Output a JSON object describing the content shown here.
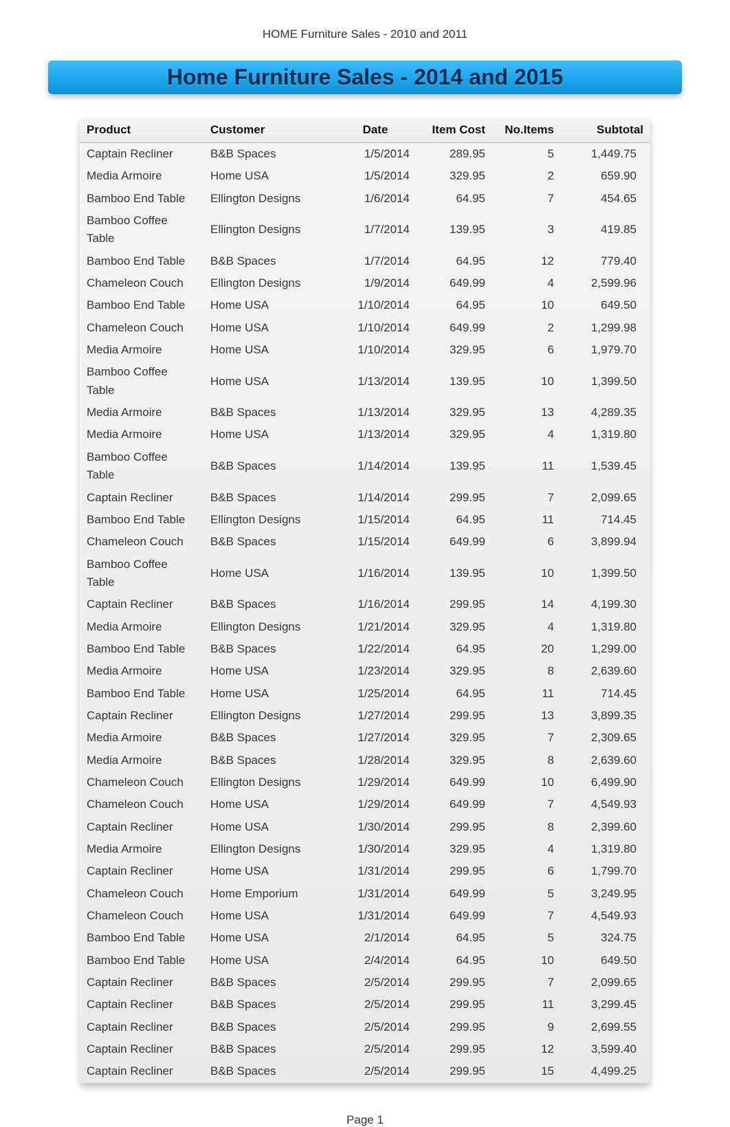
{
  "doc_header": "HOME Furniture Sales - 2010 and 2011",
  "title": "Home Furniture Sales - 2014 and 2015",
  "columns": {
    "product": "Product",
    "customer": "Customer",
    "date": "Date",
    "item_cost": "Item Cost",
    "no_items": "No.Items",
    "subtotal": "Subtotal"
  },
  "rows": [
    {
      "product": "Captain Recliner",
      "customer": "B&B Spaces",
      "date": "1/5/2014",
      "item_cost": "289.95",
      "no_items": "5",
      "subtotal": "1,449.75"
    },
    {
      "product": "Media Armoire",
      "customer": "Home USA",
      "date": "1/5/2014",
      "item_cost": "329.95",
      "no_items": "2",
      "subtotal": "659.90"
    },
    {
      "product": "Bamboo End Table",
      "customer": "Ellington Designs",
      "date": "1/6/2014",
      "item_cost": "64.95",
      "no_items": "7",
      "subtotal": "454.65"
    },
    {
      "product": "Bamboo Coffee Table",
      "customer": "Ellington Designs",
      "date": "1/7/2014",
      "item_cost": "139.95",
      "no_items": "3",
      "subtotal": "419.85"
    },
    {
      "product": "Bamboo End Table",
      "customer": "B&B Spaces",
      "date": "1/7/2014",
      "item_cost": "64.95",
      "no_items": "12",
      "subtotal": "779.40"
    },
    {
      "product": "Chameleon Couch",
      "customer": "Ellington Designs",
      "date": "1/9/2014",
      "item_cost": "649.99",
      "no_items": "4",
      "subtotal": "2,599.96"
    },
    {
      "product": "Bamboo End Table",
      "customer": "Home USA",
      "date": "1/10/2014",
      "item_cost": "64.95",
      "no_items": "10",
      "subtotal": "649.50"
    },
    {
      "product": "Chameleon Couch",
      "customer": "Home USA",
      "date": "1/10/2014",
      "item_cost": "649.99",
      "no_items": "2",
      "subtotal": "1,299.98"
    },
    {
      "product": "Media Armoire",
      "customer": "Home USA",
      "date": "1/10/2014",
      "item_cost": "329.95",
      "no_items": "6",
      "subtotal": "1,979.70"
    },
    {
      "product": "Bamboo Coffee Table",
      "customer": "Home USA",
      "date": "1/13/2014",
      "item_cost": "139.95",
      "no_items": "10",
      "subtotal": "1,399.50"
    },
    {
      "product": "Media Armoire",
      "customer": "B&B Spaces",
      "date": "1/13/2014",
      "item_cost": "329.95",
      "no_items": "13",
      "subtotal": "4,289.35"
    },
    {
      "product": "Media Armoire",
      "customer": "Home USA",
      "date": "1/13/2014",
      "item_cost": "329.95",
      "no_items": "4",
      "subtotal": "1,319.80"
    },
    {
      "product": "Bamboo Coffee Table",
      "customer": "B&B Spaces",
      "date": "1/14/2014",
      "item_cost": "139.95",
      "no_items": "11",
      "subtotal": "1,539.45"
    },
    {
      "product": "Captain Recliner",
      "customer": "B&B Spaces",
      "date": "1/14/2014",
      "item_cost": "299.95",
      "no_items": "7",
      "subtotal": "2,099.65"
    },
    {
      "product": "Bamboo End Table",
      "customer": "Ellington Designs",
      "date": "1/15/2014",
      "item_cost": "64.95",
      "no_items": "11",
      "subtotal": "714.45"
    },
    {
      "product": "Chameleon Couch",
      "customer": "B&B Spaces",
      "date": "1/15/2014",
      "item_cost": "649.99",
      "no_items": "6",
      "subtotal": "3,899.94"
    },
    {
      "product": "Bamboo Coffee Table",
      "customer": "Home USA",
      "date": "1/16/2014",
      "item_cost": "139.95",
      "no_items": "10",
      "subtotal": "1,399.50"
    },
    {
      "product": "Captain Recliner",
      "customer": "B&B Spaces",
      "date": "1/16/2014",
      "item_cost": "299.95",
      "no_items": "14",
      "subtotal": "4,199.30"
    },
    {
      "product": "Media Armoire",
      "customer": "Ellington Designs",
      "date": "1/21/2014",
      "item_cost": "329.95",
      "no_items": "4",
      "subtotal": "1,319.80"
    },
    {
      "product": "Bamboo End Table",
      "customer": "B&B Spaces",
      "date": "1/22/2014",
      "item_cost": "64.95",
      "no_items": "20",
      "subtotal": "1,299.00"
    },
    {
      "product": "Media Armoire",
      "customer": "Home USA",
      "date": "1/23/2014",
      "item_cost": "329.95",
      "no_items": "8",
      "subtotal": "2,639.60"
    },
    {
      "product": "Bamboo End Table",
      "customer": "Home USA",
      "date": "1/25/2014",
      "item_cost": "64.95",
      "no_items": "11",
      "subtotal": "714.45"
    },
    {
      "product": "Captain Recliner",
      "customer": "Ellington Designs",
      "date": "1/27/2014",
      "item_cost": "299.95",
      "no_items": "13",
      "subtotal": "3,899.35"
    },
    {
      "product": "Media Armoire",
      "customer": "B&B Spaces",
      "date": "1/27/2014",
      "item_cost": "329.95",
      "no_items": "7",
      "subtotal": "2,309.65"
    },
    {
      "product": "Media Armoire",
      "customer": "B&B Spaces",
      "date": "1/28/2014",
      "item_cost": "329.95",
      "no_items": "8",
      "subtotal": "2,639.60"
    },
    {
      "product": "Chameleon Couch",
      "customer": "Ellington Designs",
      "date": "1/29/2014",
      "item_cost": "649.99",
      "no_items": "10",
      "subtotal": "6,499.90"
    },
    {
      "product": "Chameleon Couch",
      "customer": "Home USA",
      "date": "1/29/2014",
      "item_cost": "649.99",
      "no_items": "7",
      "subtotal": "4,549.93"
    },
    {
      "product": "Captain Recliner",
      "customer": "Home USA",
      "date": "1/30/2014",
      "item_cost": "299.95",
      "no_items": "8",
      "subtotal": "2,399.60"
    },
    {
      "product": "Media Armoire",
      "customer": "Ellington Designs",
      "date": "1/30/2014",
      "item_cost": "329.95",
      "no_items": "4",
      "subtotal": "1,319.80"
    },
    {
      "product": "Captain Recliner",
      "customer": "Home USA",
      "date": "1/31/2014",
      "item_cost": "299.95",
      "no_items": "6",
      "subtotal": "1,799.70"
    },
    {
      "product": "Chameleon Couch",
      "customer": "Home Emporium",
      "date": "1/31/2014",
      "item_cost": "649.99",
      "no_items": "5",
      "subtotal": "3,249.95"
    },
    {
      "product": "Chameleon Couch",
      "customer": "Home USA",
      "date": "1/31/2014",
      "item_cost": "649.99",
      "no_items": "7",
      "subtotal": "4,549.93"
    },
    {
      "product": "Bamboo End Table",
      "customer": "Home USA",
      "date": "2/1/2014",
      "item_cost": "64.95",
      "no_items": "5",
      "subtotal": "324.75"
    },
    {
      "product": "Bamboo End Table",
      "customer": "Home USA",
      "date": "2/4/2014",
      "item_cost": "64.95",
      "no_items": "10",
      "subtotal": "649.50"
    },
    {
      "product": "Captain Recliner",
      "customer": "B&B Spaces",
      "date": "2/5/2014",
      "item_cost": "299.95",
      "no_items": "7",
      "subtotal": "2,099.65"
    },
    {
      "product": "Captain Recliner",
      "customer": "B&B Spaces",
      "date": "2/5/2014",
      "item_cost": "299.95",
      "no_items": "11",
      "subtotal": "3,299.45"
    },
    {
      "product": "Captain Recliner",
      "customer": "B&B Spaces",
      "date": "2/5/2014",
      "item_cost": "299.95",
      "no_items": "9",
      "subtotal": "2,699.55"
    },
    {
      "product": "Captain Recliner",
      "customer": "B&B Spaces",
      "date": "2/5/2014",
      "item_cost": "299.95",
      "no_items": "12",
      "subtotal": "3,599.40"
    },
    {
      "product": "Captain Recliner",
      "customer": "B&B Spaces",
      "date": "2/5/2014",
      "item_cost": "299.95",
      "no_items": "15",
      "subtotal": "4,499.25"
    }
  ],
  "footer": "Page 1"
}
